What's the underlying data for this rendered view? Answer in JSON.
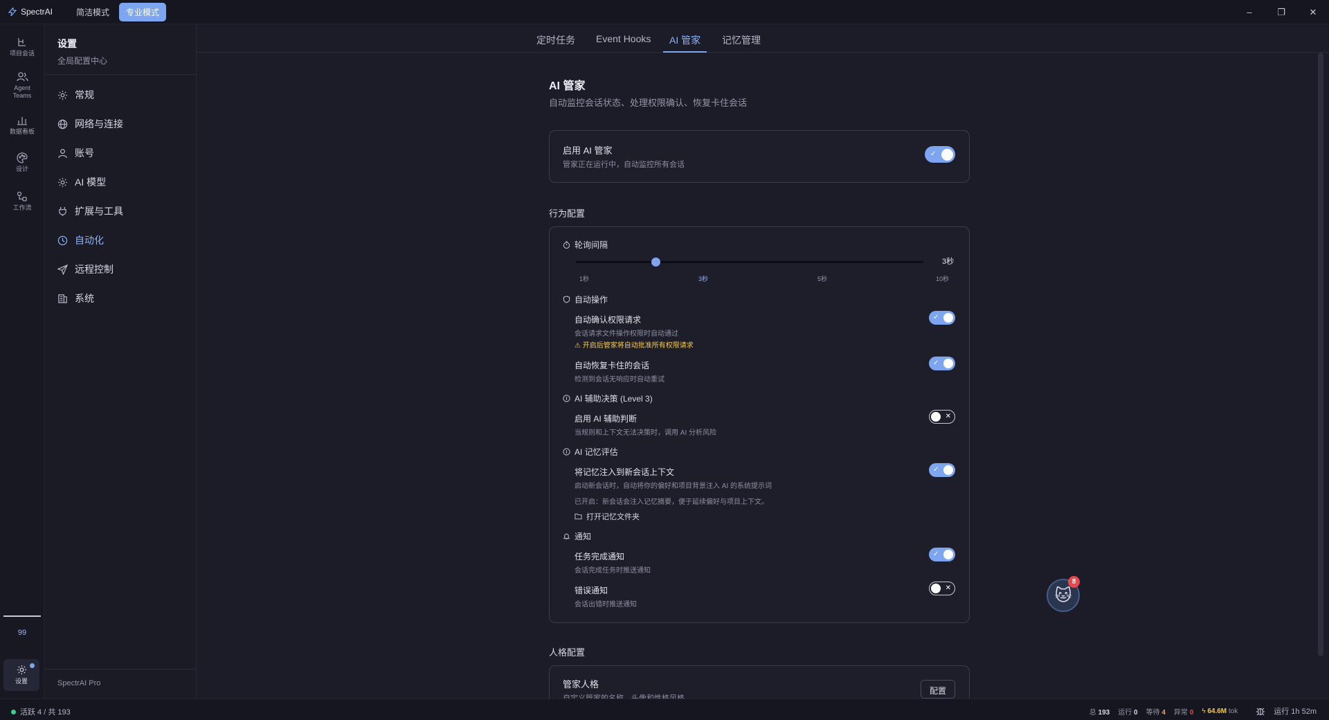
{
  "app": {
    "name": "SpectrAI"
  },
  "modes": [
    "简洁模式",
    "专业模式"
  ],
  "window_controls": {
    "minimize": "–",
    "restore": "❐",
    "close": "✕"
  },
  "rail": {
    "items": [
      {
        "label": "项目会话",
        "icon": "sessions-icon"
      },
      {
        "label": "Agent\nTeams",
        "icon": "team-icon"
      },
      {
        "label": "数据看板",
        "icon": "chart-icon"
      },
      {
        "label": "设计",
        "icon": "palette-icon"
      },
      {
        "label": "工作流",
        "icon": "workflow-icon"
      }
    ],
    "count": "99",
    "settings_label": "设置"
  },
  "sidebar": {
    "title": "设置",
    "subtitle": "全局配置中心",
    "items": [
      {
        "label": "常规",
        "icon": "gear-icon"
      },
      {
        "label": "网络与连接",
        "icon": "globe-icon"
      },
      {
        "label": "账号",
        "icon": "user-icon"
      },
      {
        "label": "AI 模型",
        "icon": "gear-icon"
      },
      {
        "label": "扩展与工具",
        "icon": "plug-icon"
      },
      {
        "label": "自动化",
        "icon": "clock-icon"
      },
      {
        "label": "远程控制",
        "icon": "send-icon"
      },
      {
        "label": "系统",
        "icon": "system-icon"
      }
    ],
    "active_index": 5,
    "footer": "SpectrAI Pro"
  },
  "tabs": [
    "定时任务",
    "Event Hooks",
    "AI 管家",
    "记忆管理"
  ],
  "active_tab": 2,
  "page": {
    "title": "AI 管家",
    "subtitle": "自动监控会话状态、处理权限确认、恢复卡住会话"
  },
  "enable_card": {
    "title": "启用 AI 管家",
    "desc": "管家正在运行中，自动监控所有会话",
    "enabled": true
  },
  "behavior": {
    "section_label": "行为配置",
    "polling": {
      "label": "轮询间隔",
      "value_label": "3秒",
      "ticks": [
        "1秒",
        "3秒",
        "5秒",
        "10秒"
      ],
      "value_fraction": 0.23
    },
    "auto_ops": {
      "label": "自动操作",
      "items": [
        {
          "title": "自动确认权限请求",
          "desc": "会话请求文件操作权限时自动通过",
          "warning": "⚠ 开启后管家将自动批准所有权限请求",
          "enabled": true
        },
        {
          "title": "自动恢复卡住的会话",
          "desc": "检测到会话无响应时自动重试",
          "enabled": true
        }
      ]
    },
    "ai_decision": {
      "label": "AI 辅助决策 (Level 3)",
      "items": [
        {
          "title": "启用 AI 辅助判断",
          "desc": "当规则和上下文无法决策时，调用 AI 分析风险",
          "enabled": false
        }
      ]
    },
    "ai_memory": {
      "label": "AI 记忆评估",
      "items": [
        {
          "title": "将记忆注入到新会话上下文",
          "desc": "启动新会话时，自动将你的偏好和项目背景注入 AI 的系统提示词",
          "enabled": true
        }
      ],
      "note": "已开启：新会话会注入记忆摘要，便于延续偏好与项目上下文。",
      "open_folder": "打开记忆文件夹"
    },
    "notify": {
      "label": "通知",
      "items": [
        {
          "title": "任务完成通知",
          "desc": "会话完成任务时推送通知",
          "enabled": true
        },
        {
          "title": "错误通知",
          "desc": "会话出错时推送通知",
          "enabled": false
        }
      ]
    }
  },
  "persona": {
    "section_label": "人格配置",
    "title": "管家人格",
    "desc": "自定义管家的名称、头像和性格风格",
    "button": "配置"
  },
  "mascot": {
    "badge": "8",
    "emoji": "🐱"
  },
  "status_bar": {
    "left": "活跃 4 / 共 193",
    "total_label": "总",
    "total": "193",
    "running_label": "运行",
    "running": "0",
    "waiting_label": "等待",
    "waiting": "4",
    "error_label": "异常",
    "error": "0",
    "tokens": "64.6M",
    "tokens_unit": "tok",
    "uptime": "运行 1h 52m",
    "colors": {
      "ok": "#3ecf8e",
      "warn": "#f0a050",
      "err": "#e5484d"
    }
  }
}
